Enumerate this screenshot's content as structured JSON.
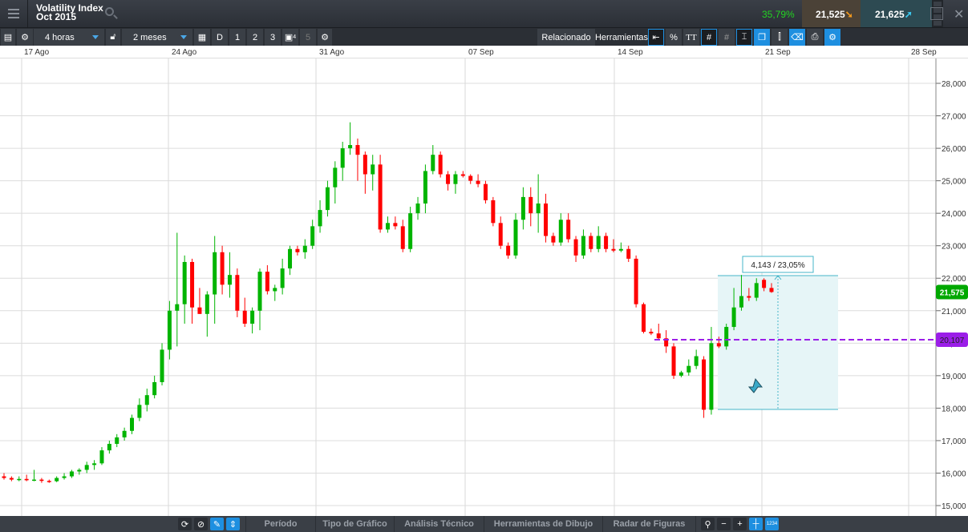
{
  "header": {
    "title_line1": "Volatility Index",
    "title_line2": "Oct 2015",
    "change_pct": "35,79%",
    "sell_price": "21,525",
    "buy_price": "21,625"
  },
  "toolbar": {
    "interval": "4 horas",
    "range": "2 meses",
    "buttons": [
      "D",
      "1",
      "2",
      "3",
      "4",
      "5"
    ],
    "related": "Relacionado",
    "tools": "Herramientas",
    "percent": "%",
    "text_tool": "TT"
  },
  "date_axis": [
    "17 Ago",
    "24 Ago",
    "31 Ago",
    "07 Sep",
    "14 Sep",
    "21 Sep",
    "28 Sep"
  ],
  "bottom": {
    "tabs": [
      "Período",
      "Tipo de Gráfico",
      "Análisis Técnico",
      "Herramientas de Dibujo",
      "Radar de Figuras"
    ],
    "zoom_out": "−",
    "zoom_in": "+",
    "counter": "1234"
  },
  "colors": {
    "up": "#00b400",
    "down": "#ff0000",
    "level": "#9b1ee8",
    "last": "#00a800",
    "measure": "#45b5c8"
  },
  "chart_data": {
    "type": "candlestick",
    "ylim": [
      14800,
      28400
    ],
    "y_ticks": [
      "15,000",
      "16,000",
      "17,000",
      "18,000",
      "19,000",
      "20,000",
      "21,000",
      "22,000",
      "23,000",
      "24,000",
      "25,000",
      "26,000",
      "27,000",
      "28,000"
    ],
    "y_tick_values": [
      15000,
      16000,
      17000,
      18000,
      19000,
      20000,
      21000,
      22000,
      23000,
      24000,
      25000,
      26000,
      27000,
      28000
    ],
    "last_price": {
      "value": 21575,
      "label": "21,575"
    },
    "level_line": {
      "value": 20107,
      "label": "20,107"
    },
    "measurement": {
      "from": 17960,
      "to": 22080,
      "label": "4,143 / 23,05%"
    },
    "candles_ohlc_thousands": [
      [
        15.9,
        16.0,
        15.8,
        15.85
      ],
      [
        15.85,
        15.9,
        15.75,
        15.8
      ],
      [
        15.8,
        15.9,
        15.75,
        15.82
      ],
      [
        15.82,
        15.95,
        15.75,
        15.78
      ],
      [
        15.78,
        16.1,
        15.75,
        15.8
      ],
      [
        15.8,
        15.85,
        15.7,
        15.76
      ],
      [
        15.76,
        15.8,
        15.7,
        15.75
      ],
      [
        15.75,
        15.9,
        15.72,
        15.85
      ],
      [
        15.85,
        16.0,
        15.8,
        15.9
      ],
      [
        15.9,
        16.1,
        15.85,
        16.05
      ],
      [
        16.05,
        16.15,
        15.95,
        16.1
      ],
      [
        16.1,
        16.35,
        16.0,
        16.25
      ],
      [
        16.25,
        16.4,
        16.1,
        16.3
      ],
      [
        16.3,
        16.8,
        16.25,
        16.7
      ],
      [
        16.7,
        17.0,
        16.6,
        16.9
      ],
      [
        16.9,
        17.2,
        16.8,
        17.1
      ],
      [
        17.1,
        17.4,
        17.0,
        17.3
      ],
      [
        17.3,
        17.8,
        17.2,
        17.7
      ],
      [
        17.7,
        18.3,
        17.6,
        18.1
      ],
      [
        18.1,
        18.6,
        17.9,
        18.4
      ],
      [
        18.4,
        19.0,
        18.3,
        18.8
      ],
      [
        18.8,
        20.0,
        18.7,
        19.8
      ],
      [
        19.8,
        21.3,
        19.5,
        21.0
      ],
      [
        21.0,
        23.4,
        19.9,
        21.2
      ],
      [
        21.2,
        22.7,
        20.6,
        22.5
      ],
      [
        22.5,
        22.6,
        20.6,
        21.1
      ],
      [
        21.1,
        21.7,
        20.9,
        20.9
      ],
      [
        20.9,
        21.6,
        20.2,
        21.5
      ],
      [
        21.5,
        23.3,
        20.6,
        22.8
      ],
      [
        22.8,
        23.0,
        21.5,
        21.8
      ],
      [
        21.8,
        22.8,
        21.4,
        22.1
      ],
      [
        22.1,
        22.3,
        20.8,
        21.0
      ],
      [
        21.0,
        21.4,
        20.5,
        20.6
      ],
      [
        20.6,
        21.1,
        20.3,
        21.0
      ],
      [
        21.0,
        22.3,
        20.4,
        22.2
      ],
      [
        22.2,
        22.4,
        21.5,
        21.6
      ],
      [
        21.6,
        21.8,
        21.3,
        21.7
      ],
      [
        21.7,
        22.6,
        21.5,
        22.3
      ],
      [
        22.3,
        23.0,
        22.1,
        22.9
      ],
      [
        22.9,
        23.0,
        22.7,
        22.8
      ],
      [
        22.8,
        23.2,
        22.6,
        23.0
      ],
      [
        23.0,
        23.8,
        22.9,
        23.6
      ],
      [
        23.6,
        24.4,
        23.4,
        24.1
      ],
      [
        24.1,
        25.0,
        23.9,
        24.8
      ],
      [
        24.8,
        25.6,
        24.3,
        25.4
      ],
      [
        25.4,
        26.2,
        25.0,
        26.0
      ],
      [
        26.0,
        26.8,
        25.8,
        26.1
      ],
      [
        26.1,
        26.3,
        25.0,
        25.8
      ],
      [
        25.8,
        25.9,
        24.6,
        25.2
      ],
      [
        25.2,
        25.8,
        24.7,
        25.5
      ],
      [
        25.5,
        25.8,
        23.4,
        23.5
      ],
      [
        23.5,
        23.9,
        23.4,
        23.7
      ],
      [
        23.7,
        23.9,
        23.5,
        23.6
      ],
      [
        23.6,
        23.8,
        22.8,
        22.9
      ],
      [
        22.9,
        24.2,
        22.8,
        24.0
      ],
      [
        24.0,
        24.5,
        23.8,
        24.3
      ],
      [
        24.3,
        25.5,
        24.0,
        25.3
      ],
      [
        25.3,
        26.1,
        25.2,
        25.8
      ],
      [
        25.8,
        25.9,
        25.1,
        25.2
      ],
      [
        25.2,
        25.3,
        24.7,
        24.9
      ],
      [
        24.9,
        25.3,
        24.6,
        25.2
      ],
      [
        25.2,
        25.3,
        25.1,
        25.15
      ],
      [
        25.15,
        25.2,
        24.9,
        25.0
      ],
      [
        25.0,
        25.2,
        24.8,
        24.9
      ],
      [
        24.9,
        25.0,
        24.3,
        24.4
      ],
      [
        24.4,
        24.5,
        23.6,
        23.7
      ],
      [
        23.7,
        23.9,
        22.9,
        23.0
      ],
      [
        23.0,
        23.1,
        22.6,
        22.7
      ],
      [
        22.7,
        24.0,
        22.6,
        23.8
      ],
      [
        23.8,
        24.8,
        23.5,
        24.5
      ],
      [
        24.5,
        24.8,
        23.6,
        24.0
      ],
      [
        24.0,
        25.2,
        23.4,
        24.3
      ],
      [
        24.3,
        24.6,
        23.1,
        23.3
      ],
      [
        23.3,
        23.4,
        23.0,
        23.1
      ],
      [
        23.1,
        24.0,
        23.0,
        23.8
      ],
      [
        23.8,
        24.0,
        23.1,
        23.2
      ],
      [
        23.2,
        23.3,
        22.5,
        22.7
      ],
      [
        22.7,
        23.5,
        22.6,
        23.3
      ],
      [
        23.3,
        23.4,
        22.8,
        22.9
      ],
      [
        22.9,
        23.6,
        22.8,
        23.3
      ],
      [
        23.3,
        23.4,
        22.8,
        22.9
      ],
      [
        22.9,
        23.2,
        22.8,
        22.85
      ],
      [
        22.85,
        23.1,
        22.8,
        22.9
      ],
      [
        22.9,
        23.0,
        22.5,
        22.6
      ],
      [
        22.6,
        22.7,
        21.1,
        21.2
      ],
      [
        21.2,
        21.25,
        20.3,
        20.35
      ],
      [
        20.35,
        20.45,
        20.25,
        20.3
      ],
      [
        20.3,
        20.6,
        20.1,
        20.15
      ],
      [
        20.15,
        20.4,
        19.7,
        19.9
      ],
      [
        19.9,
        20.0,
        18.9,
        19.0
      ],
      [
        19.0,
        19.15,
        18.95,
        19.1
      ],
      [
        19.1,
        19.5,
        19.0,
        19.3
      ],
      [
        19.3,
        19.8,
        19.2,
        19.6
      ],
      [
        19.5,
        19.6,
        17.7,
        17.95
      ],
      [
        17.95,
        20.5,
        17.8,
        20.0
      ],
      [
        20.0,
        20.2,
        19.85,
        19.9
      ],
      [
        19.9,
        20.6,
        19.8,
        20.5
      ],
      [
        20.5,
        21.7,
        20.4,
        21.1
      ],
      [
        21.1,
        22.1,
        21.0,
        21.45
      ],
      [
        21.45,
        21.7,
        21.3,
        21.4
      ],
      [
        21.4,
        22.0,
        21.3,
        21.85
      ],
      [
        21.95,
        22.0,
        21.6,
        21.7
      ],
      [
        21.7,
        21.85,
        21.55,
        21.575
      ]
    ]
  }
}
